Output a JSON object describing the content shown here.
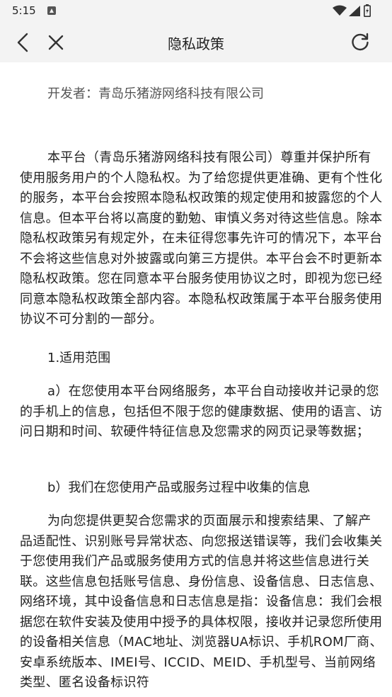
{
  "status_bar": {
    "time": "5:15"
  },
  "nav": {
    "title": "隐私政策"
  },
  "content": {
    "developer": "开发者：青岛乐猪游网络科技有限公司",
    "intro": "本平台（青岛乐猪游网络科技有限公司）尊重并保护所有使用服务用户的个人隐私权。为了给您提供更准确、更有个性化的服务，本平台会按照本隐私权政策的规定使用和披露您的个人信息。但本平台将以高度的勤勉、审慎义务对待这些信息。除本隐私权政策另有规定外，在未征得您事先许可的情况下，本平台不会将这些信息对外披露或向第三方提供。本平台会不时更新本隐私权政策。您在同意本平台服务使用协议之时，即视为您已经同意本隐私权政策全部内容。本隐私权政策属于本平台服务使用协议不可分割的一部分。",
    "section1_title": "1.适用范围",
    "section1_a": "a）在您使用本平台网络服务，本平台自动接收并记录的您的手机上的信息，包括但不限于您的健康数据、使用的语言、访问日期和时间、软硬件特征信息及您需求的网页记录等数据；",
    "section1_b_title": "b）我们在您使用产品或服务过程中收集的信息",
    "section1_b_body": "为向您提供更契合您需求的页面展示和搜索结果、了解产品适配性、识别账号异常状态、向您报送错误等，我们会收集关于您使用我们产品或服务使用方式的信息并将这些信息进行关联。这些信息包括账号信息、身份信息、设备信息、日志信息、网络环境，其中设备信息和日志信息是指：设备信息：我们会根据您在软件安装及使用中授予的具体权限，接收并记录您所使用的设备相关信息（MAC地址、浏览器UA标识、手机ROM厂商、安卓系统版本、IMEI号、ICCID、MEID、手机型号、当前网络类型、匿名设备标识符"
  }
}
